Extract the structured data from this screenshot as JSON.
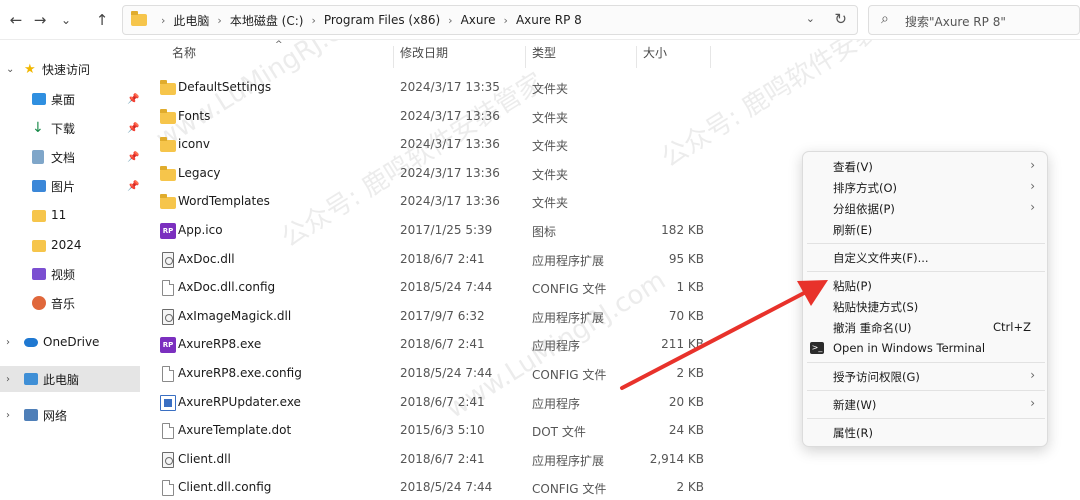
{
  "toolbar": {
    "back_icon": "←",
    "forward_icon": "→",
    "history_icon": "⌄",
    "up_icon": "↑",
    "breadcrumbs": [
      "此电脑",
      "本地磁盘 (C:)",
      "Program Files (x86)",
      "Axure",
      "Axure RP 8"
    ],
    "dropdown_icon": "⌄",
    "refresh_icon": "↻",
    "search_icon": "⌕",
    "search_placeholder": "搜索\"Axure RP 8\""
  },
  "sidebar": {
    "quick_access": "快速访问",
    "items": [
      {
        "label": "桌面"
      },
      {
        "label": "下载"
      },
      {
        "label": "文档"
      },
      {
        "label": "图片"
      },
      {
        "label": "11"
      },
      {
        "label": "2024"
      },
      {
        "label": "视频"
      },
      {
        "label": "音乐"
      }
    ],
    "onedrive": "OneDrive",
    "this_pc": "此电脑",
    "network": "网络"
  },
  "columns": {
    "name": "名称",
    "modified": "修改日期",
    "type": "类型",
    "size": "大小"
  },
  "files": [
    {
      "name": "DefaultSettings",
      "date": "2024/3/17 13:35",
      "type": "文件夹",
      "size": "",
      "icon": "folder-icon"
    },
    {
      "name": "Fonts",
      "date": "2024/3/17 13:36",
      "type": "文件夹",
      "size": "",
      "icon": "folder-icon"
    },
    {
      "name": "iconv",
      "date": "2024/3/17 13:36",
      "type": "文件夹",
      "size": "",
      "icon": "folder-icon"
    },
    {
      "name": "Legacy",
      "date": "2024/3/17 13:36",
      "type": "文件夹",
      "size": "",
      "icon": "folder-icon"
    },
    {
      "name": "WordTemplates",
      "date": "2024/3/17 13:36",
      "type": "文件夹",
      "size": "",
      "icon": "folder-icon"
    },
    {
      "name": "App.ico",
      "date": "2017/1/25 5:39",
      "type": "图标",
      "size": "182 KB",
      "icon": "axure-rp-icon"
    },
    {
      "name": "AxDoc.dll",
      "date": "2018/6/7 2:41",
      "type": "应用程序扩展",
      "size": "95 KB",
      "icon": "dll-file-icon"
    },
    {
      "name": "AxDoc.dll.config",
      "date": "2018/5/24 7:44",
      "type": "CONFIG 文件",
      "size": "1 KB",
      "icon": "file-icon"
    },
    {
      "name": "AxImageMagick.dll",
      "date": "2017/9/7 6:32",
      "type": "应用程序扩展",
      "size": "70 KB",
      "icon": "dll-file-icon"
    },
    {
      "name": "AxureRP8.exe",
      "date": "2018/6/7 2:41",
      "type": "应用程序",
      "size": "211 KB",
      "icon": "axure-rp-icon"
    },
    {
      "name": "AxureRP8.exe.config",
      "date": "2018/5/24 7:44",
      "type": "CONFIG 文件",
      "size": "2 KB",
      "icon": "file-icon"
    },
    {
      "name": "AxureRPUpdater.exe",
      "date": "2018/6/7 2:41",
      "type": "应用程序",
      "size": "20 KB",
      "icon": "updater-icon"
    },
    {
      "name": "AxureTemplate.dot",
      "date": "2015/6/3 5:10",
      "type": "DOT 文件",
      "size": "24 KB",
      "icon": "file-icon"
    },
    {
      "name": "Client.dll",
      "date": "2018/6/7 2:41",
      "type": "应用程序扩展",
      "size": "2,914 KB",
      "icon": "dll-file-icon"
    },
    {
      "name": "Client.dll.config",
      "date": "2018/5/24 7:44",
      "type": "CONFIG 文件",
      "size": "2 KB",
      "icon": "file-icon"
    }
  ],
  "context_menu": {
    "view": "查看(V)",
    "sort": "排序方式(O)",
    "group": "分组依据(P)",
    "refresh": "刷新(E)",
    "customize": "自定义文件夹(F)...",
    "paste": "粘贴(P)",
    "paste_shortcut": "粘贴快捷方式(S)",
    "undo": "撤消 重命名(U)",
    "undo_shortcut": "Ctrl+Z",
    "terminal": "Open in Windows Terminal",
    "grant_access": "授予访问权限(G)",
    "new": "新建(W)",
    "properties": "属性(R)",
    "submenu_arrow": "›"
  },
  "annotation": {
    "arrow_color": "#e8322b"
  },
  "watermark": {
    "text_a": "公众号: 鹿鸣软件安装管家",
    "text_b": "www.LuMingRJ.com"
  }
}
